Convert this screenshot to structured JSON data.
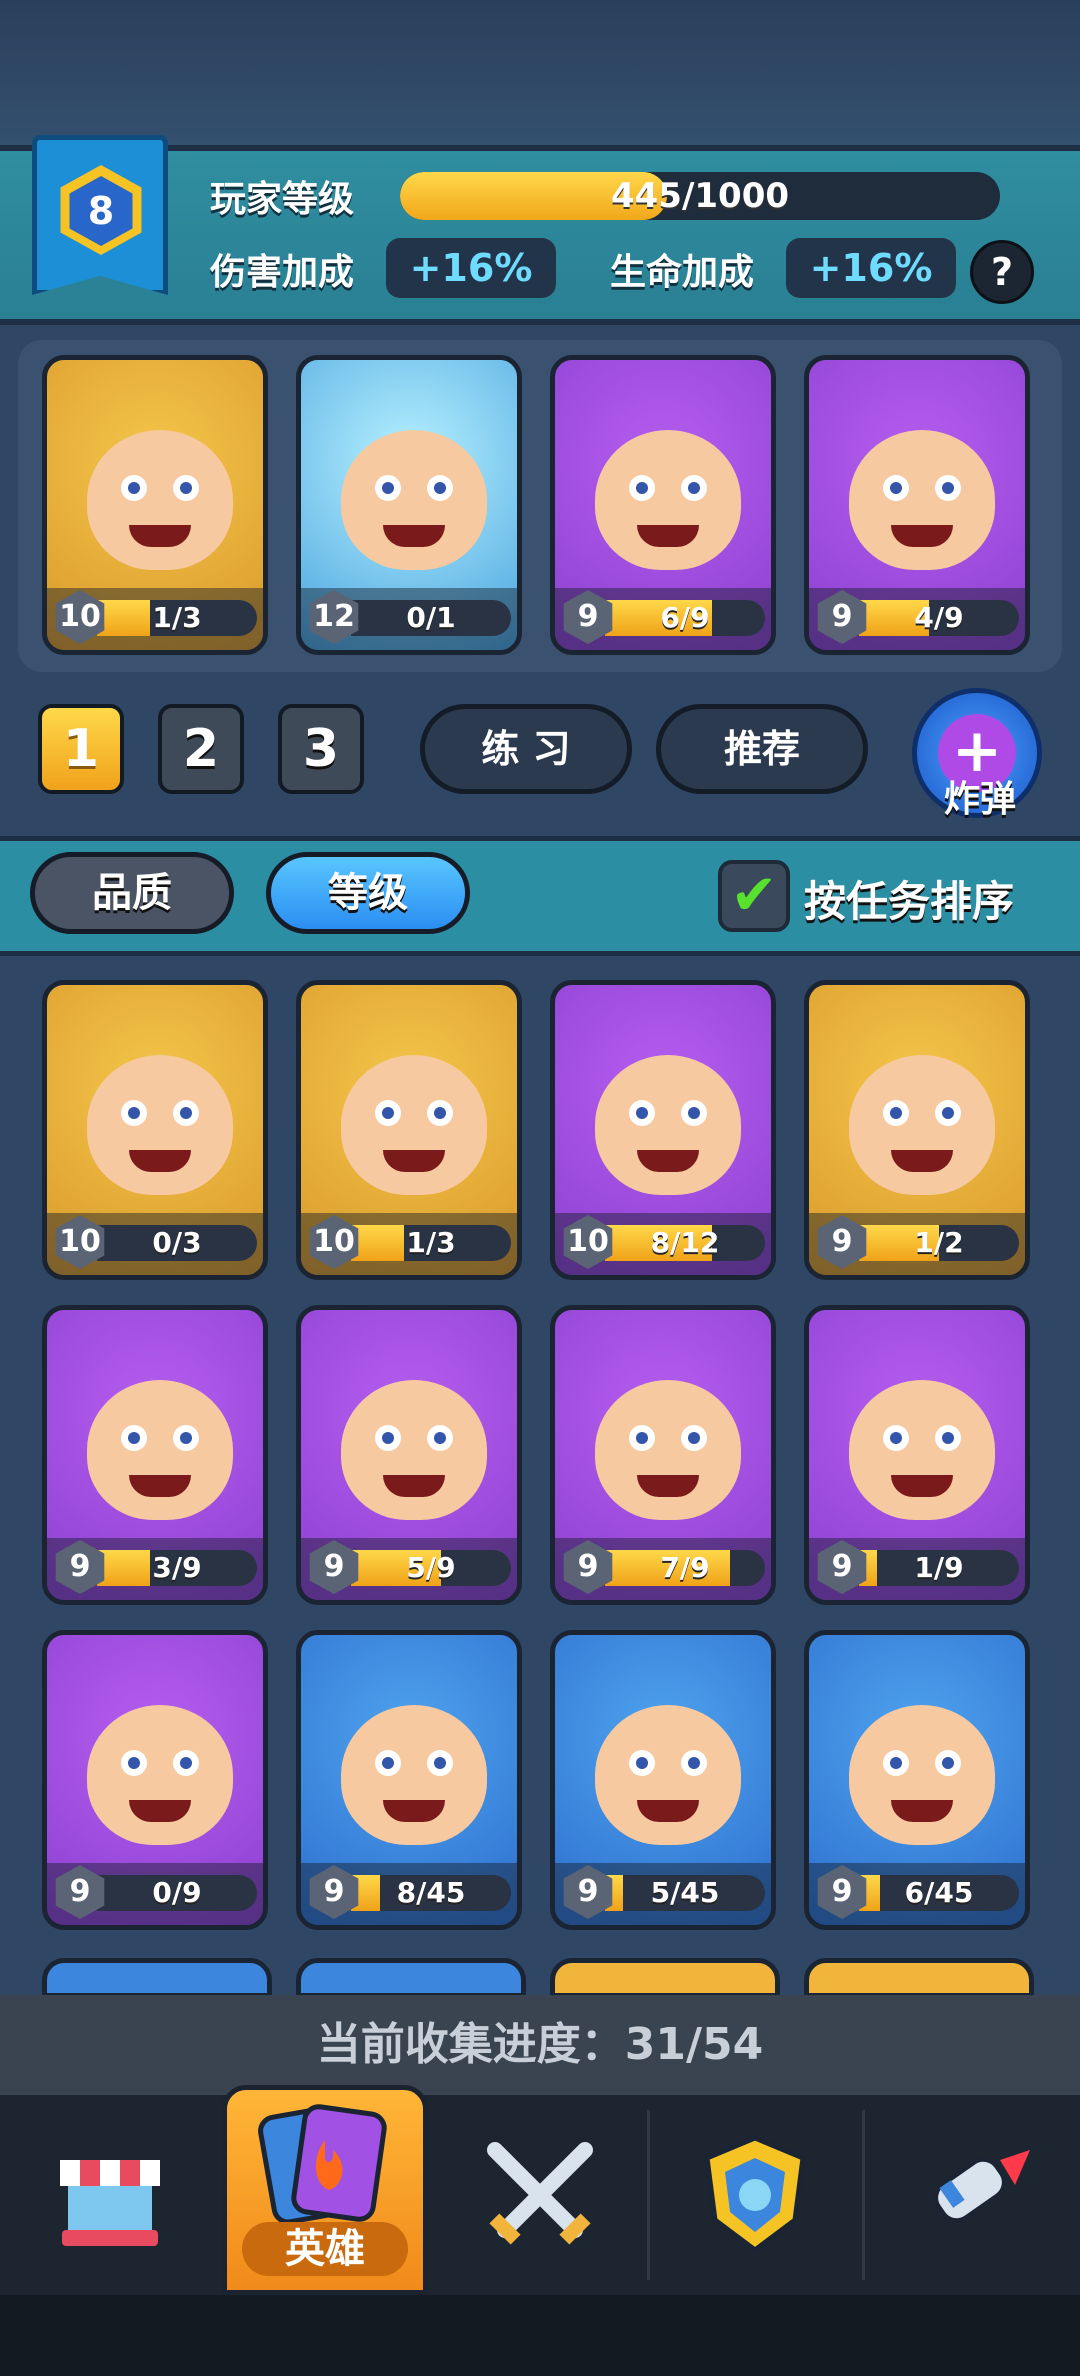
{
  "player": {
    "level": "8",
    "level_label": "玩家等级",
    "xp_text": "445/1000",
    "xp_fraction": 0.445,
    "damage_label": "伤害加成",
    "damage_value": "+16%",
    "health_label": "生命加成",
    "health_value": "+16%",
    "help_label": "?"
  },
  "team": [
    {
      "level": "10",
      "progress": "1/3",
      "fill": 0.33,
      "color": "gold"
    },
    {
      "level": "12",
      "progress": "0/1",
      "fill": 0.0,
      "color": "ice"
    },
    {
      "level": "9",
      "progress": "6/9",
      "fill": 0.67,
      "color": "purple"
    },
    {
      "level": "9",
      "progress": "4/9",
      "fill": 0.44,
      "color": "purple"
    }
  ],
  "deck_tabs": [
    "1",
    "2",
    "3"
  ],
  "buttons": {
    "practice": "练 习",
    "recommend": "推荐",
    "bomb_label": "炸弹",
    "bomb_icon": "+"
  },
  "sort": {
    "quality": "品质",
    "level": "等级",
    "check_mark": "✔",
    "task_sort": "按任务排序"
  },
  "heroes": [
    {
      "level": "10",
      "progress": "0/3",
      "fill": 0.0,
      "color": "gold"
    },
    {
      "level": "10",
      "progress": "1/3",
      "fill": 0.33,
      "color": "gold"
    },
    {
      "level": "10",
      "progress": "8/12",
      "fill": 0.67,
      "color": "purple"
    },
    {
      "level": "9",
      "progress": "1/2",
      "fill": 0.5,
      "color": "gold"
    },
    {
      "level": "9",
      "progress": "3/9",
      "fill": 0.33,
      "color": "purple"
    },
    {
      "level": "9",
      "progress": "5/9",
      "fill": 0.56,
      "color": "purple"
    },
    {
      "level": "9",
      "progress": "7/9",
      "fill": 0.78,
      "color": "purple"
    },
    {
      "level": "9",
      "progress": "1/9",
      "fill": 0.11,
      "color": "purple"
    },
    {
      "level": "9",
      "progress": "0/9",
      "fill": 0.0,
      "color": "purple"
    },
    {
      "level": "9",
      "progress": "8/45",
      "fill": 0.18,
      "color": "blue"
    },
    {
      "level": "9",
      "progress": "5/45",
      "fill": 0.11,
      "color": "blue"
    },
    {
      "level": "9",
      "progress": "6/45",
      "fill": 0.13,
      "color": "blue"
    }
  ],
  "collection": {
    "text": "当前收集进度：31/54"
  },
  "nav": {
    "shop_icon": "shop-icon",
    "heroes_label": "英雄",
    "battle_icon": "crossed-swords-icon",
    "clan_icon": "shield-icon",
    "events_icon": "rocket-icon"
  },
  "colors": {
    "gold": "#f0b53a",
    "purple": "#a151e3",
    "blue": "#3c86de",
    "ice": "#8ad6f5",
    "accent": "#6fdcff"
  }
}
